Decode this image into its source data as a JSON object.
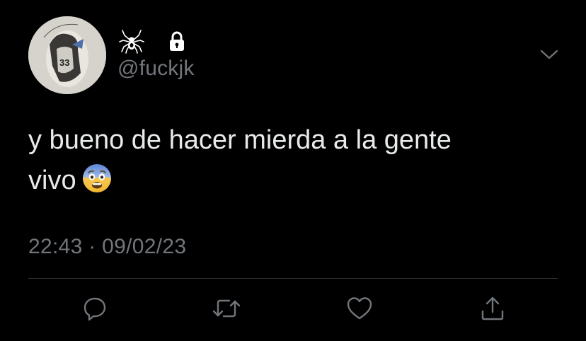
{
  "tweet": {
    "name_icons": [
      "spider-emoji",
      "lock-icon"
    ],
    "handle": "@fuckjk",
    "text_line_1": "y bueno de hacer mierda a la gente",
    "text_line_2": "vivo",
    "emoji": "fearful-face",
    "timestamp": "22:43 · 09/02/23"
  },
  "colors": {
    "background": "#000000",
    "primary_text": "#e7e9ea",
    "secondary_text": "#71767b",
    "divider": "#2f3336"
  },
  "actions": [
    "reply-icon",
    "retweet-icon",
    "like-icon",
    "share-icon"
  ]
}
